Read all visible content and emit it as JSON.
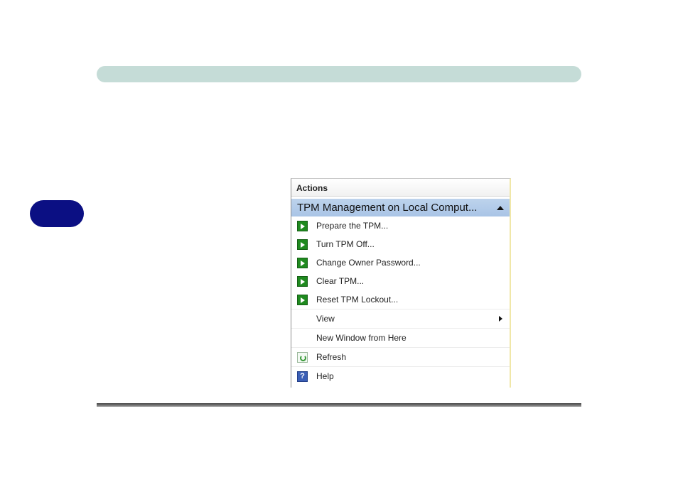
{
  "page": {
    "header_bar_color": "#c5dcd7",
    "side_tab_color": "#0b0f83"
  },
  "actions_panel": {
    "title": "Actions",
    "section": {
      "label": "TPM Management on Local Comput...",
      "state": "expanded",
      "highlight_color": "#b6cdea"
    },
    "items": [
      {
        "label": "Prepare the TPM...",
        "icon": "green-arrow-icon"
      },
      {
        "label": "Turn TPM Off...",
        "icon": "green-arrow-icon"
      },
      {
        "label": "Change Owner Password...",
        "icon": "green-arrow-icon"
      },
      {
        "label": "Clear TPM...",
        "icon": "green-arrow-icon"
      },
      {
        "label": "Reset TPM Lockout...",
        "icon": "green-arrow-icon"
      },
      {
        "label": "View",
        "icon": "none",
        "submenu": true
      },
      {
        "label": "New Window from Here",
        "icon": "none"
      },
      {
        "label": "Refresh",
        "icon": "refresh-icon"
      },
      {
        "label": "Help",
        "icon": "help-icon",
        "icon_glyph": "?"
      }
    ]
  }
}
